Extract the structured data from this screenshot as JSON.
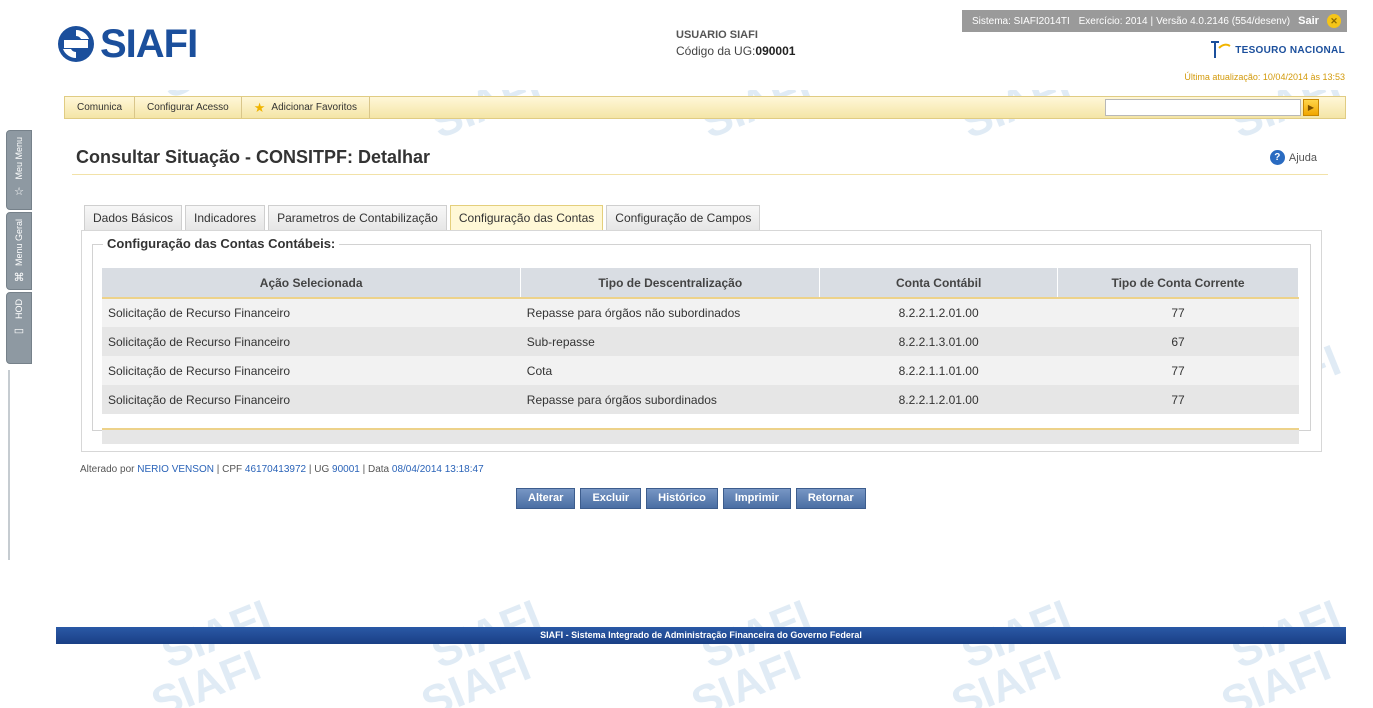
{
  "header": {
    "logo_text": "SIAFI",
    "user_label": "USUARIO SIAFI",
    "ug_label": "Código da UG:",
    "ug_value": "090001",
    "system_info": {
      "sistema": "Sistema: SIAFI2014TI",
      "exercicio": "Exercício: 2014",
      "versao": "Versão 4.0.2146 (554/desenv)"
    },
    "sair_label": "Sair",
    "tesouro_label": "TESOURO NACIONAL",
    "update_text": "Última atualização: 10/04/2014 às 13:53"
  },
  "toolbar": {
    "items": [
      "Comunica",
      "Configurar Acesso",
      "Adicionar Favoritos"
    ],
    "search_value": ""
  },
  "side_tabs": [
    "Meu Menu",
    "Menu Geral",
    "HOD"
  ],
  "page": {
    "title": "Consultar Situação - CONSITPF: Detalhar",
    "help_label": "Ajuda"
  },
  "tabs": [
    {
      "label": "Dados Básicos",
      "active": false
    },
    {
      "label": "Indicadores",
      "active": false
    },
    {
      "label": "Parametros de Contabilização",
      "active": false
    },
    {
      "label": "Configuração das Contas",
      "active": true
    },
    {
      "label": "Configuração de Campos",
      "active": false
    }
  ],
  "section": {
    "legend": "Configuração das Contas Contábeis:",
    "columns": [
      "Ação Selecionada",
      "Tipo de Descentralização",
      "Conta Contábil",
      "Tipo de Conta Corrente"
    ],
    "rows": [
      [
        "Solicitação de Recurso Financeiro",
        "Repasse para órgãos não subordinados",
        "8.2.2.1.2.01.00",
        "77"
      ],
      [
        "Solicitação de Recurso Financeiro",
        "Sub-repasse",
        "8.2.2.1.3.01.00",
        "67"
      ],
      [
        "Solicitação de Recurso Financeiro",
        "Cota",
        "8.2.2.1.1.01.00",
        "77"
      ],
      [
        "Solicitação de Recurso Financeiro",
        "Repasse para órgãos subordinados",
        "8.2.2.1.2.01.00",
        "77"
      ]
    ]
  },
  "audit": {
    "altered_by_label": "Alterado por",
    "user": "NERIO VENSON",
    "cpf_label": "CPF",
    "cpf": "46170413972",
    "ug_label": "UG",
    "ug": "90001",
    "date_label": "Data",
    "date": "08/04/2014 13:18:47"
  },
  "buttons": [
    "Alterar",
    "Excluir",
    "Histórico",
    "Imprimir",
    "Retornar"
  ],
  "footer": {
    "text": "SIAFI - Sistema Integrado de Administração Financeira do Governo Federal"
  },
  "watermark_text": "SIAFI",
  "colors": {
    "brand_blue": "#1b4f9c",
    "toolbar_yellow": "#f4e5a6",
    "button_blue": "#4a6ea3",
    "link_blue": "#2a63b8",
    "footer_blue": "#1a3f85"
  }
}
